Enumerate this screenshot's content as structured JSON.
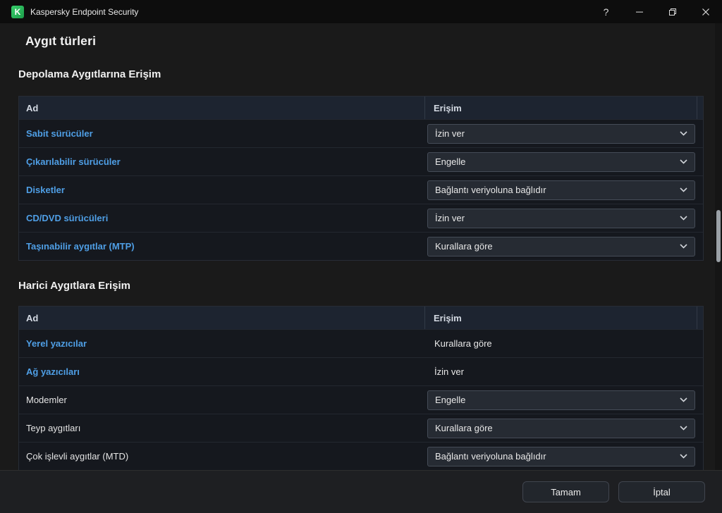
{
  "window": {
    "title": "Kaspersky Endpoint Security",
    "controls": {
      "help": "?"
    }
  },
  "icons": {
    "logo": "K",
    "minimize": "—",
    "maximize": "❐",
    "close": "✕",
    "chevron": "⌄"
  },
  "colors": {
    "link_blue": "#4f9fe6",
    "brand_green": "#2eb45c",
    "header_bg": "#1d2430",
    "row_bg": "#15181e"
  },
  "page": {
    "title": "Aygıt türleri"
  },
  "sections": [
    {
      "heading": "Depolama Aygıtlarına Erişim",
      "columns": {
        "name": "Ad",
        "access": "Erişim"
      },
      "rows": [
        {
          "name": "Sabit sürücüler",
          "value": "İzin ver"
        },
        {
          "name": "Çıkarılabilir sürücüler",
          "value": "Engelle"
        },
        {
          "name": "Disketler",
          "value": "Bağlantı veriyoluna bağlıdır"
        },
        {
          "name": "CD/DVD sürücüleri",
          "value": "İzin ver"
        },
        {
          "name": "Taşınabilir aygıtlar (MTP)",
          "value": "Kurallara göre"
        }
      ]
    },
    {
      "heading": "Harici Aygıtlara Erişim",
      "columns": {
        "name": "Ad",
        "access": "Erişim"
      },
      "rows": [
        {
          "name": "Yerel yazıcılar",
          "value": "Kurallara göre"
        },
        {
          "name": "Ağ yazıcıları",
          "value": "İzin ver"
        },
        {
          "name": "Modemler",
          "value": "Engelle"
        },
        {
          "name": "Teyp aygıtları",
          "value": "Kurallara göre"
        },
        {
          "name": "Çok işlevli aygıtlar (MTD)",
          "value": "Bağlantı veriyoluna bağlıdır"
        }
      ]
    }
  ],
  "footer": {
    "ok": "Tamam",
    "cancel": "İptal"
  }
}
